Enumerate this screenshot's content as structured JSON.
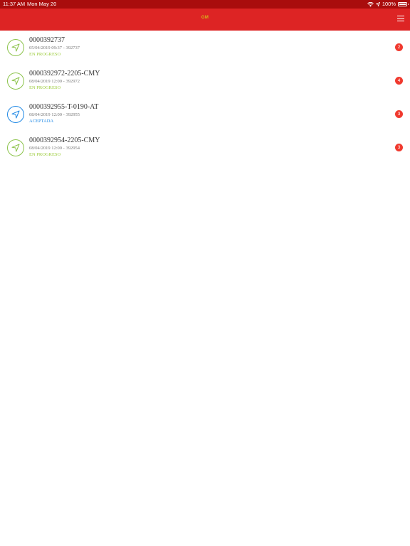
{
  "status_bar": {
    "time": "11:37 AM",
    "date": "Mon May 20",
    "battery": "100%"
  },
  "navbar": {
    "logo_text": "GM",
    "menu_icon": "hamburger-menu-icon"
  },
  "colors": {
    "navbar": "#dd2424",
    "status_bar": "#a90d0d",
    "in_progress": "#9ccc3c",
    "accepted": "#1e88e5",
    "badge": "#f03a2f"
  },
  "rows": [
    {
      "title": "0000392737",
      "subtitle": "05/04/2019 09:37 - 392737",
      "status": "EN PROGRESO",
      "badge": "2",
      "icon": "navigation-arrow-icon",
      "tone": "green"
    },
    {
      "title": "0000392972-2205-CMY",
      "subtitle": "08/04/2019 12:00 - 392972",
      "status": "EN PROGRESO",
      "badge": "4",
      "icon": "navigation-arrow-icon",
      "tone": "green"
    },
    {
      "title": "0000392955-T-0190-AT",
      "subtitle": "08/04/2019 12:00 - 392955",
      "status": "ACEPTADA",
      "badge": "3",
      "icon": "navigation-arrow-icon",
      "tone": "blue"
    },
    {
      "title": "0000392954-2205-CMY",
      "subtitle": "08/04/2019 12:00 - 392954",
      "status": "EN PROGRESO",
      "badge": "3",
      "icon": "navigation-arrow-icon",
      "tone": "green"
    }
  ]
}
